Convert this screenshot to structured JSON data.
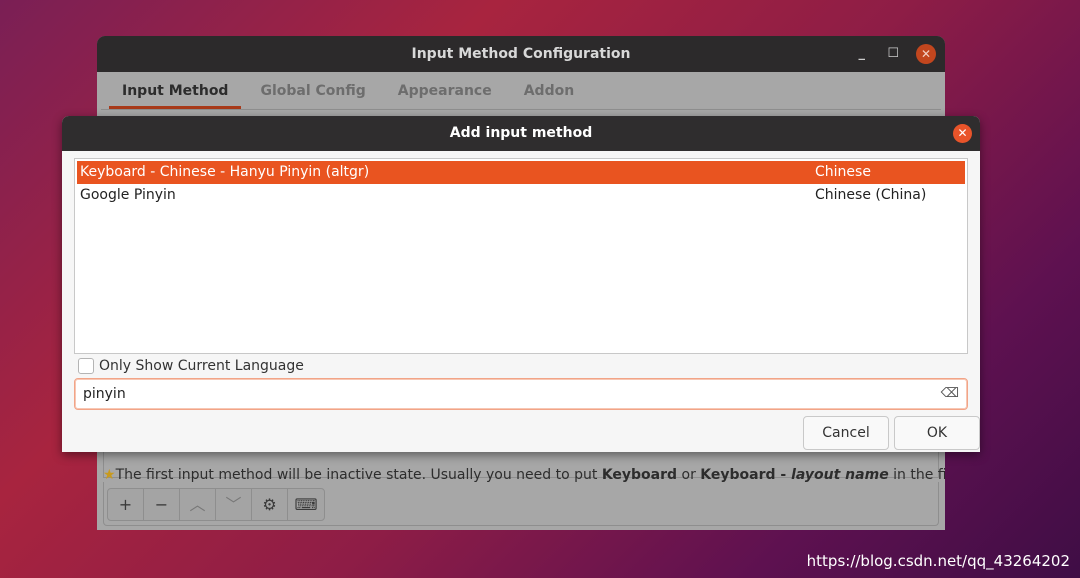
{
  "main_window": {
    "title": "Input Method Configuration",
    "tabs": [
      "Input Method",
      "Global Config",
      "Appearance",
      "Addon"
    ],
    "note": {
      "pre": "The first input method will be inactive state. Usually you need to put ",
      "b1": "Keyboard",
      "mid": " or ",
      "b2": "Keyboard - ",
      "i": "layout name",
      "post": " in the first place."
    },
    "toolbar": [
      "+",
      "−",
      "︿",
      "﹀",
      "⚙",
      "⌨"
    ]
  },
  "dialog": {
    "title": "Add input method",
    "items": [
      {
        "name": "Keyboard - Chinese - Hanyu Pinyin (altgr)",
        "language": "Chinese",
        "selected": true
      },
      {
        "name": "Google Pinyin",
        "language": "Chinese (China)",
        "selected": false
      }
    ],
    "only_current_language_label": "Only Show Current Language",
    "only_current_language": false,
    "search_value": "pinyin",
    "cancel": "Cancel",
    "ok": "OK"
  },
  "accent": "#e95420",
  "watermark": "https://blog.csdn.net/qq_43264202"
}
